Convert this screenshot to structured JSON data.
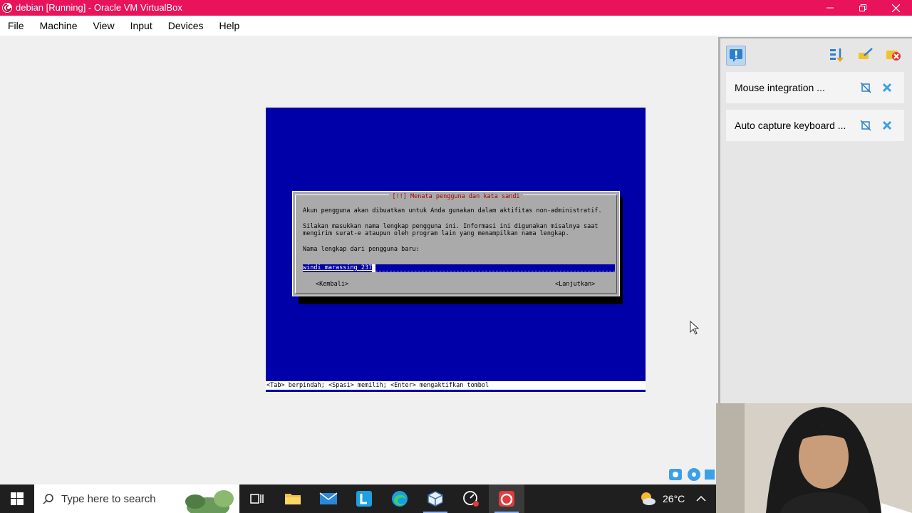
{
  "window": {
    "title": "debian [Running] - Oracle VM VirtualBox",
    "accent": "#e8135a"
  },
  "menu": [
    "File",
    "Machine",
    "View",
    "Input",
    "Devices",
    "Help"
  ],
  "installer": {
    "dialog_title": "[!!] Menata pengguna dan kata sandi",
    "line1": "Akun pengguna akan dibuatkan untuk Anda gunakan dalam aktifitas non-administratif.",
    "line2": "Silakan masukkan nama lengkap pengguna ini. Informasi ini digunakan misalnya saat",
    "line3": "mengirim surat-e ataupun oleh program lain yang menampilkan nama lengkap.",
    "prompt": "Nama lengkap dari pengguna baru:",
    "input_value": "windi marassing_237",
    "back_button": "<Kembali>",
    "continue_button": "<Lanjutkan>",
    "status_line": "<Tab> berpindah; <Spasi> memilih; <Enter> mengaktifkan tombol",
    "screen_color": "#0000a8",
    "dialog_color": "#aaaaaa"
  },
  "notifications": {
    "items": [
      {
        "label": "Mouse integration ..."
      },
      {
        "label": "Auto capture keyboard ..."
      }
    ]
  },
  "taskbar": {
    "search_placeholder": "Type here to search",
    "temperature": "26°C"
  }
}
